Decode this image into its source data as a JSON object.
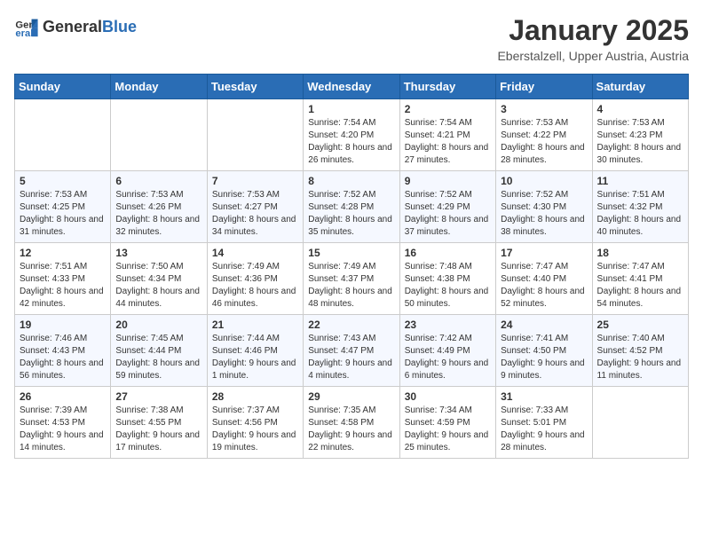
{
  "header": {
    "logo_general": "General",
    "logo_blue": "Blue",
    "title": "January 2025",
    "subtitle": "Eberstalzell, Upper Austria, Austria"
  },
  "weekdays": [
    "Sunday",
    "Monday",
    "Tuesday",
    "Wednesday",
    "Thursday",
    "Friday",
    "Saturday"
  ],
  "weeks": [
    [
      {
        "day": "",
        "sunrise": "",
        "sunset": "",
        "daylight": ""
      },
      {
        "day": "",
        "sunrise": "",
        "sunset": "",
        "daylight": ""
      },
      {
        "day": "",
        "sunrise": "",
        "sunset": "",
        "daylight": ""
      },
      {
        "day": "1",
        "sunrise": "Sunrise: 7:54 AM",
        "sunset": "Sunset: 4:20 PM",
        "daylight": "Daylight: 8 hours and 26 minutes."
      },
      {
        "day": "2",
        "sunrise": "Sunrise: 7:54 AM",
        "sunset": "Sunset: 4:21 PM",
        "daylight": "Daylight: 8 hours and 27 minutes."
      },
      {
        "day": "3",
        "sunrise": "Sunrise: 7:53 AM",
        "sunset": "Sunset: 4:22 PM",
        "daylight": "Daylight: 8 hours and 28 minutes."
      },
      {
        "day": "4",
        "sunrise": "Sunrise: 7:53 AM",
        "sunset": "Sunset: 4:23 PM",
        "daylight": "Daylight: 8 hours and 30 minutes."
      }
    ],
    [
      {
        "day": "5",
        "sunrise": "Sunrise: 7:53 AM",
        "sunset": "Sunset: 4:25 PM",
        "daylight": "Daylight: 8 hours and 31 minutes."
      },
      {
        "day": "6",
        "sunrise": "Sunrise: 7:53 AM",
        "sunset": "Sunset: 4:26 PM",
        "daylight": "Daylight: 8 hours and 32 minutes."
      },
      {
        "day": "7",
        "sunrise": "Sunrise: 7:53 AM",
        "sunset": "Sunset: 4:27 PM",
        "daylight": "Daylight: 8 hours and 34 minutes."
      },
      {
        "day": "8",
        "sunrise": "Sunrise: 7:52 AM",
        "sunset": "Sunset: 4:28 PM",
        "daylight": "Daylight: 8 hours and 35 minutes."
      },
      {
        "day": "9",
        "sunrise": "Sunrise: 7:52 AM",
        "sunset": "Sunset: 4:29 PM",
        "daylight": "Daylight: 8 hours and 37 minutes."
      },
      {
        "day": "10",
        "sunrise": "Sunrise: 7:52 AM",
        "sunset": "Sunset: 4:30 PM",
        "daylight": "Daylight: 8 hours and 38 minutes."
      },
      {
        "day": "11",
        "sunrise": "Sunrise: 7:51 AM",
        "sunset": "Sunset: 4:32 PM",
        "daylight": "Daylight: 8 hours and 40 minutes."
      }
    ],
    [
      {
        "day": "12",
        "sunrise": "Sunrise: 7:51 AM",
        "sunset": "Sunset: 4:33 PM",
        "daylight": "Daylight: 8 hours and 42 minutes."
      },
      {
        "day": "13",
        "sunrise": "Sunrise: 7:50 AM",
        "sunset": "Sunset: 4:34 PM",
        "daylight": "Daylight: 8 hours and 44 minutes."
      },
      {
        "day": "14",
        "sunrise": "Sunrise: 7:49 AM",
        "sunset": "Sunset: 4:36 PM",
        "daylight": "Daylight: 8 hours and 46 minutes."
      },
      {
        "day": "15",
        "sunrise": "Sunrise: 7:49 AM",
        "sunset": "Sunset: 4:37 PM",
        "daylight": "Daylight: 8 hours and 48 minutes."
      },
      {
        "day": "16",
        "sunrise": "Sunrise: 7:48 AM",
        "sunset": "Sunset: 4:38 PM",
        "daylight": "Daylight: 8 hours and 50 minutes."
      },
      {
        "day": "17",
        "sunrise": "Sunrise: 7:47 AM",
        "sunset": "Sunset: 4:40 PM",
        "daylight": "Daylight: 8 hours and 52 minutes."
      },
      {
        "day": "18",
        "sunrise": "Sunrise: 7:47 AM",
        "sunset": "Sunset: 4:41 PM",
        "daylight": "Daylight: 8 hours and 54 minutes."
      }
    ],
    [
      {
        "day": "19",
        "sunrise": "Sunrise: 7:46 AM",
        "sunset": "Sunset: 4:43 PM",
        "daylight": "Daylight: 8 hours and 56 minutes."
      },
      {
        "day": "20",
        "sunrise": "Sunrise: 7:45 AM",
        "sunset": "Sunset: 4:44 PM",
        "daylight": "Daylight: 8 hours and 59 minutes."
      },
      {
        "day": "21",
        "sunrise": "Sunrise: 7:44 AM",
        "sunset": "Sunset: 4:46 PM",
        "daylight": "Daylight: 9 hours and 1 minute."
      },
      {
        "day": "22",
        "sunrise": "Sunrise: 7:43 AM",
        "sunset": "Sunset: 4:47 PM",
        "daylight": "Daylight: 9 hours and 4 minutes."
      },
      {
        "day": "23",
        "sunrise": "Sunrise: 7:42 AM",
        "sunset": "Sunset: 4:49 PM",
        "daylight": "Daylight: 9 hours and 6 minutes."
      },
      {
        "day": "24",
        "sunrise": "Sunrise: 7:41 AM",
        "sunset": "Sunset: 4:50 PM",
        "daylight": "Daylight: 9 hours and 9 minutes."
      },
      {
        "day": "25",
        "sunrise": "Sunrise: 7:40 AM",
        "sunset": "Sunset: 4:52 PM",
        "daylight": "Daylight: 9 hours and 11 minutes."
      }
    ],
    [
      {
        "day": "26",
        "sunrise": "Sunrise: 7:39 AM",
        "sunset": "Sunset: 4:53 PM",
        "daylight": "Daylight: 9 hours and 14 minutes."
      },
      {
        "day": "27",
        "sunrise": "Sunrise: 7:38 AM",
        "sunset": "Sunset: 4:55 PM",
        "daylight": "Daylight: 9 hours and 17 minutes."
      },
      {
        "day": "28",
        "sunrise": "Sunrise: 7:37 AM",
        "sunset": "Sunset: 4:56 PM",
        "daylight": "Daylight: 9 hours and 19 minutes."
      },
      {
        "day": "29",
        "sunrise": "Sunrise: 7:35 AM",
        "sunset": "Sunset: 4:58 PM",
        "daylight": "Daylight: 9 hours and 22 minutes."
      },
      {
        "day": "30",
        "sunrise": "Sunrise: 7:34 AM",
        "sunset": "Sunset: 4:59 PM",
        "daylight": "Daylight: 9 hours and 25 minutes."
      },
      {
        "day": "31",
        "sunrise": "Sunrise: 7:33 AM",
        "sunset": "Sunset: 5:01 PM",
        "daylight": "Daylight: 9 hours and 28 minutes."
      },
      {
        "day": "",
        "sunrise": "",
        "sunset": "",
        "daylight": ""
      }
    ]
  ]
}
